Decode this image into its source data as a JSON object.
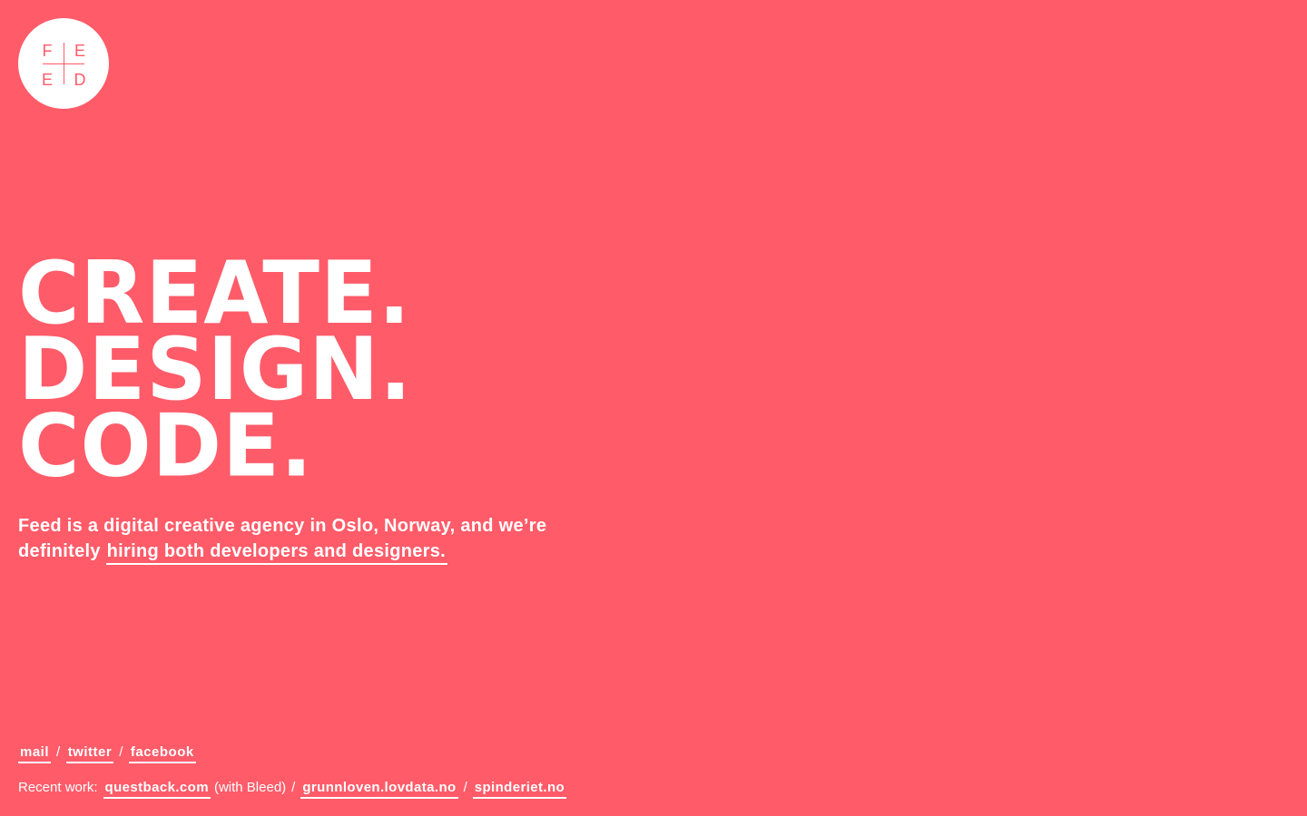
{
  "brand": {
    "logo_letters": [
      "F",
      "E",
      "E",
      "D"
    ],
    "background_color": "#ff5b69",
    "text_color": "#ffffff"
  },
  "headline": {
    "line1": "CREATE.",
    "line2": "DESIGN.",
    "line3": "CODE."
  },
  "intro": {
    "text": "Feed is a digital creative agency in Oslo, Norway, and we’re definitely",
    "link_text": "hiring both developers and designers."
  },
  "social": {
    "mail": "mail",
    "twitter": "twitter",
    "facebook": "facebook",
    "separator": "/"
  },
  "recent_work": {
    "label": "Recent work:",
    "items": [
      {
        "label": "questback.com",
        "note": "(with Bleed)"
      },
      {
        "label": "grunnloven.lovdata.no"
      },
      {
        "label": "spinderiet.no"
      }
    ],
    "separator": "/"
  }
}
